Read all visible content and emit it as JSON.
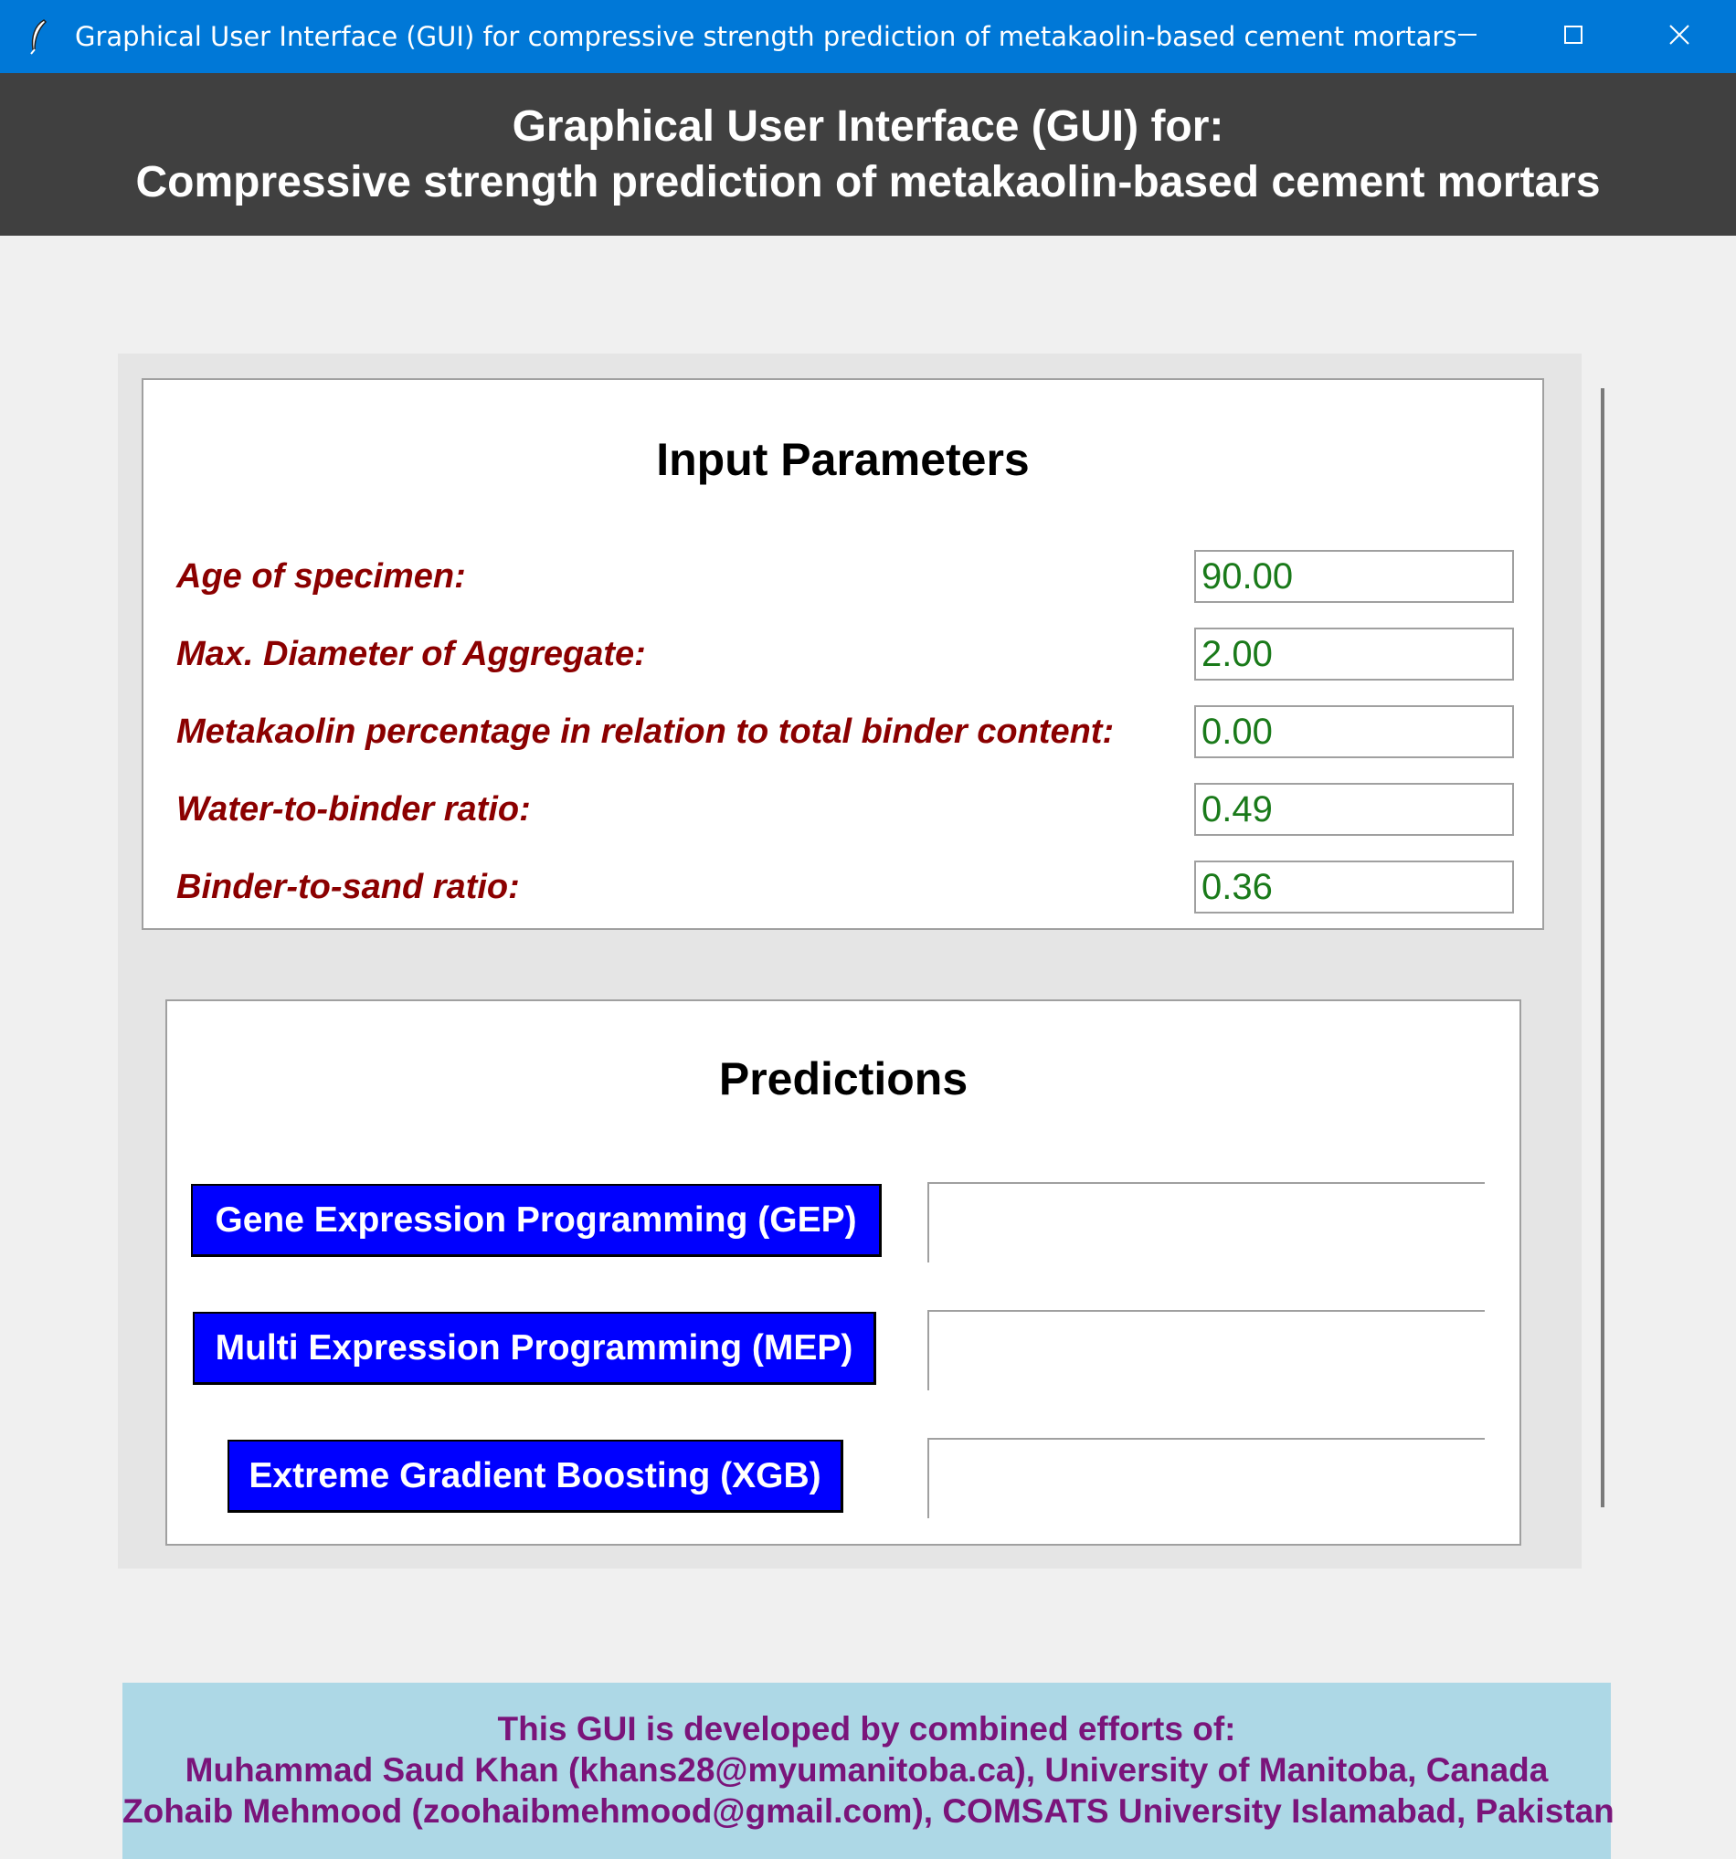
{
  "window": {
    "title": "Graphical User Interface (GUI) for compressive strength prediction of metakaolin-based cement mortars",
    "icon": "feather-icon",
    "controls": [
      "minimize-icon",
      "maximize-icon",
      "close-icon"
    ]
  },
  "header": {
    "line1": "Graphical User Interface (GUI) for:",
    "line2": "Compressive strength prediction of metakaolin-based cement mortars"
  },
  "inputs": {
    "title": "Input Parameters",
    "params": [
      {
        "label": "Age of specimen:",
        "value": "90.00"
      },
      {
        "label": "Max. Diameter of Aggregate:",
        "value": "2.00"
      },
      {
        "label": "Metakaolin percentage in relation to total binder content:",
        "value": "0.00"
      },
      {
        "label": "Water-to-binder ratio:",
        "value": "0.49"
      },
      {
        "label": "Binder-to-sand ratio:",
        "value": "0.36"
      }
    ]
  },
  "predictions": {
    "title": "Predictions",
    "models": [
      {
        "label": "Gene Expression Programming (GEP)",
        "result": ""
      },
      {
        "label": "Multi Expression Programming (MEP)",
        "result": ""
      },
      {
        "label": "Extreme Gradient Boosting (XGB)",
        "result": ""
      }
    ]
  },
  "credits": {
    "line1": "This GUI is developed by combined efforts of:",
    "line2": "Muhammad Saud Khan (khans28@myumanitoba.ca), University of Manitoba, Canada",
    "line3": "Zohaib Mehmood (zoohaibmehmood@gmail.com), COMSATS University Islamabad, Pakistan"
  },
  "colors": {
    "titlebar": "#0078d7",
    "header": "#404040",
    "label": "#8b0000",
    "input_text": "#1a7a1a",
    "button": "#0000ff",
    "credits_bg": "#add8e6",
    "credits_text": "#7a147a"
  }
}
